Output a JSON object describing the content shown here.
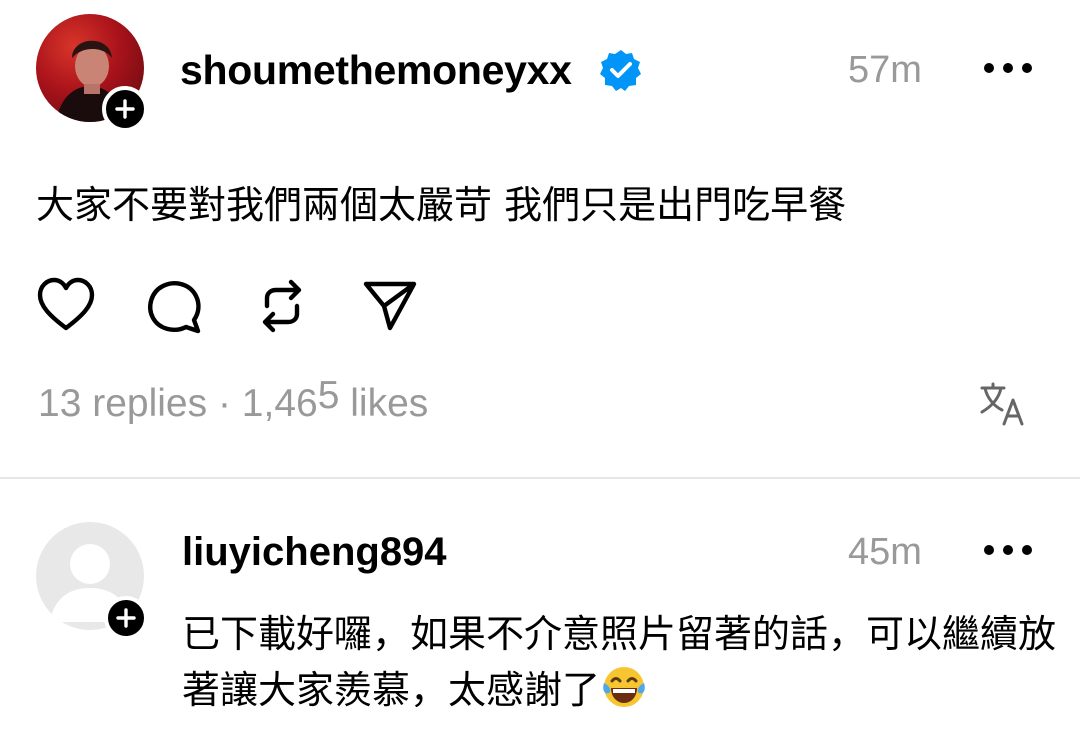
{
  "post": {
    "username": "shoumethemoneyxx",
    "time": "57m",
    "text": "大家不要對我們兩個太嚴苛 我們只是出門吃早餐",
    "replies": "13 replies",
    "separator": "·",
    "likes_main": "1,46",
    "likes_sup": "5",
    "likes_label": "likes"
  },
  "reply": {
    "username": "liuyicheng894",
    "time": "45m",
    "text": "已下載好囉，如果不介意照片留著的話，可以繼續放著讓大家羨慕，太感謝了"
  },
  "icons": {
    "verified": "verified-badge-icon",
    "heart": "heart-icon",
    "comment": "comment-icon",
    "repost": "repost-icon",
    "share": "send-icon",
    "translate": "translate-icon",
    "more": "more-icon",
    "follow": "plus-icon",
    "emoji": "laughing-tears-emoji"
  },
  "colors": {
    "verified": "#0095f6",
    "muted": "#999999"
  }
}
